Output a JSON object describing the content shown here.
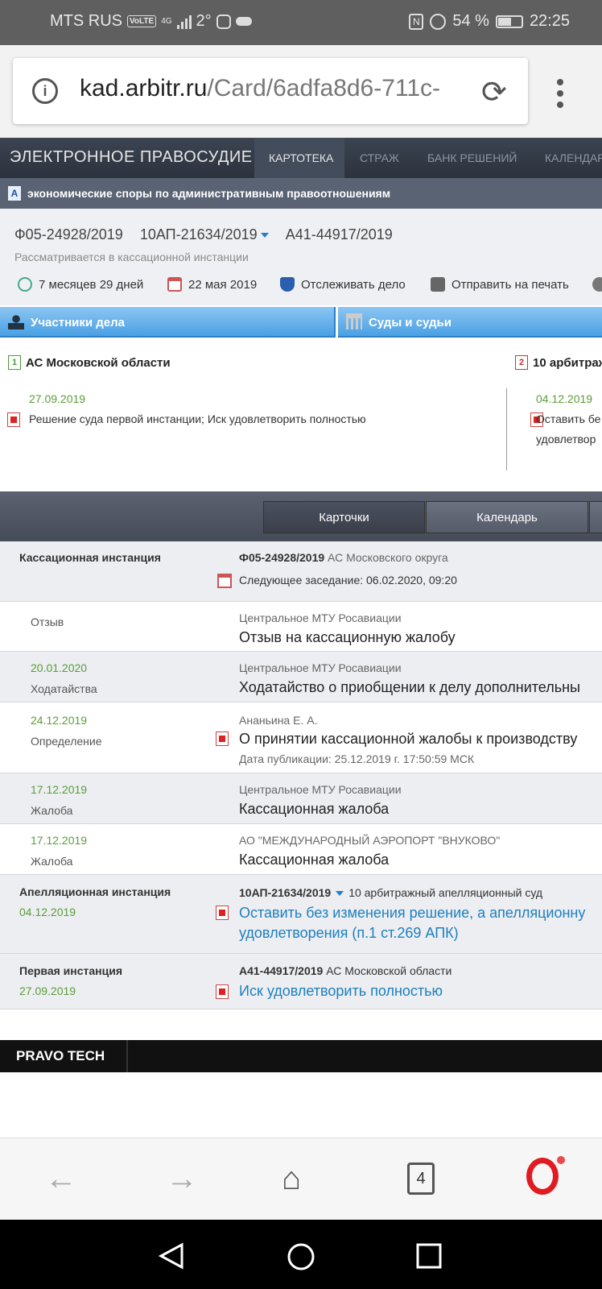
{
  "status_bar": {
    "carrier": "MTS RUS",
    "volte": "VoLTE",
    "net": "4G",
    "temp": "2°",
    "battery": "54 %",
    "time": "22:25"
  },
  "browser": {
    "url_host": "kad.arbitr.ru",
    "url_path": "/Card/6adfa8d6-711c-",
    "tab_count": "4"
  },
  "site": {
    "brand": "ЭЛЕКТРОННОЕ ПРАВОСУДИЕ",
    "nav": [
      "КАРТОТЕКА",
      "СТРАЖ",
      "БАНК РЕШЕНИЙ",
      "КАЛЕНДАРЬ"
    ],
    "category_icon": "A",
    "category": "экономические споры по административным правоотношениям"
  },
  "case": {
    "numbers": [
      "Ф05-24928/2019",
      "10АП-21634/2019",
      "А41-44917/2019"
    ],
    "status": "Рассматривается в кассационной инстанции",
    "duration": "7 месяцев 29 дней",
    "date": "22 мая 2019",
    "track": "Отслеживать дело",
    "print": "Отправить на печать"
  },
  "tabs": {
    "participants": "Участники дела",
    "courts": "Суды и судьи"
  },
  "courts": [
    {
      "num": "1",
      "name": "АС Московской области",
      "date": "27.09.2019",
      "decision": "Решение суда первой инстанции; Иск удовлетворить полностью"
    },
    {
      "num": "2",
      "name": "10 арбитраж",
      "date": "04.12.2019",
      "decision_l1": "Оставить бе",
      "decision_l2": "удовлетвор"
    }
  ],
  "view_tabs": {
    "cards": "Карточки",
    "calendar": "Календарь"
  },
  "instances": {
    "cassation": {
      "label": "Кассационная инстанция",
      "num": "Ф05-24928/2019",
      "court": "АС Московского округа",
      "next": "Следующее заседание: 06.02.2020, 09:20"
    },
    "docs": [
      {
        "date": "",
        "type": "Отзыв",
        "author": "Центральное МТУ Росавиации",
        "title": "Отзыв на кассационную жалобу"
      },
      {
        "date": "20.01.2020",
        "type": "Ходатайства",
        "author": "Центральное МТУ Росавиации",
        "title": "Ходатайство о приобщении к делу дополнительны"
      },
      {
        "date": "24.12.2019",
        "type": "Определение",
        "author": "Ананьина Е. А.",
        "title": "О принятии кассационной жалобы к производству",
        "pub": "Дата публикации: 25.12.2019 г. 17:50:59 МСК"
      },
      {
        "date": "17.12.2019",
        "type": "Жалоба",
        "author": "Центральное МТУ Росавиации",
        "title": "Кассационная жалоба"
      },
      {
        "date": "17.12.2019",
        "type": "Жалоба",
        "author": "АО \"МЕЖДУНАРОДНЫЙ АЭРОПОРТ \"ВНУКОВО\"",
        "title": "Кассационная жалоба"
      }
    ],
    "appeal": {
      "label": "Апелляционная инстанция",
      "date": "04.12.2019",
      "num": "10АП-21634/2019",
      "court": "10 арбитражный апелляционный суд",
      "link_l1": "Оставить без изменения решение, а апелляционну",
      "link_l2": "удовлетворения (п.1 ст.269 АПК)"
    },
    "first": {
      "label": "Первая инстанция",
      "date": "27.09.2019",
      "num": "А41-44917/2019",
      "court": "АС Московской области",
      "link": "Иск удовлетворить полностью"
    }
  },
  "footer": {
    "brand": "PRAVO TECH"
  }
}
